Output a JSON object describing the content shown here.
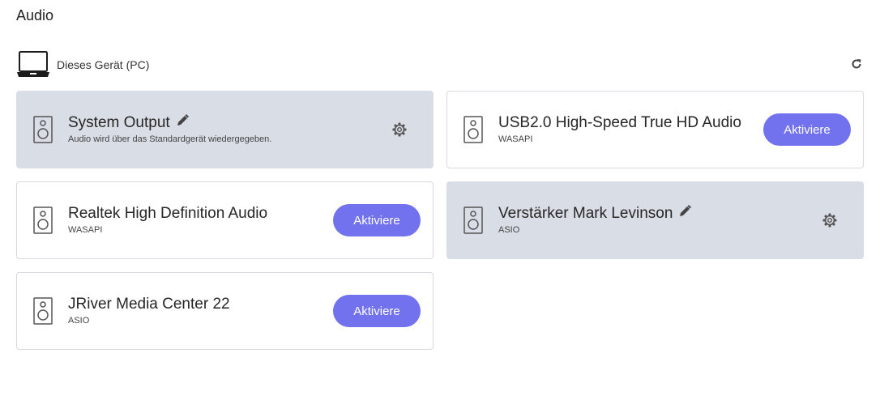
{
  "page": {
    "title": "Audio"
  },
  "device": {
    "label": "Dieses Gerät (PC)",
    "icon": "laptop-icon"
  },
  "colors": {
    "accent": "#7272ee",
    "active_card": "#d9dde5",
    "border": "#d7d9de"
  },
  "outputs": [
    {
      "title": "System Output",
      "subtitle": "Audio wird über das Standardgerät wiedergegeben.",
      "state": "active",
      "editable": true
    },
    {
      "title": "USB2.0 High-Speed True HD Audio",
      "subtitle": "WASAPI",
      "state": "inactive",
      "button": "Aktiviere"
    },
    {
      "title": "Realtek High Definition Audio",
      "subtitle": "WASAPI",
      "state": "inactive",
      "button": "Aktiviere"
    },
    {
      "title": "Verstärker Mark Levinson",
      "subtitle": "ASIO",
      "state": "active",
      "editable": true
    },
    {
      "title": "JRiver Media Center 22",
      "subtitle": "ASIO",
      "state": "inactive",
      "button": "Aktiviere"
    }
  ]
}
